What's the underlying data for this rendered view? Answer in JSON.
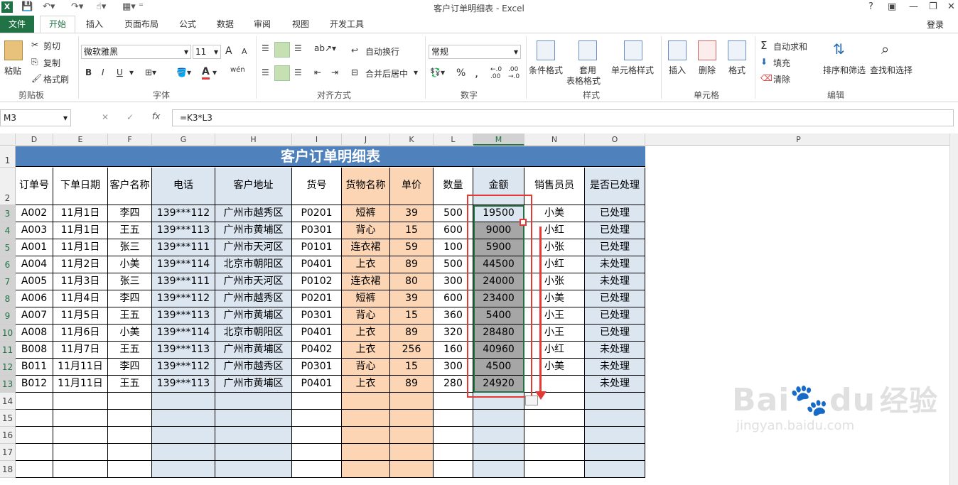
{
  "window": {
    "title": "客户订单明细表 - Excel",
    "help": "?",
    "app_icon": "X"
  },
  "tabs": [
    "文件",
    "开始",
    "插入",
    "页面布局",
    "公式",
    "数据",
    "审阅",
    "视图",
    "开发工具"
  ],
  "login": "登录",
  "ribbon": {
    "clipboard": {
      "paste": "粘贴",
      "cut": "剪切",
      "copy": "复制",
      "format_painter": "格式刷",
      "label": "剪贴板"
    },
    "font": {
      "name": "微软雅黑",
      "size": "11",
      "label": "字体",
      "bold": "B",
      "italic": "I",
      "underline": "U",
      "grow": "A",
      "shrink": "A",
      "color_a": "A",
      "phonetic": "wén"
    },
    "alignment": {
      "wrap": "自动换行",
      "merge": "合并后居中",
      "label": "对齐方式"
    },
    "number": {
      "format": "常规",
      "percent": "%",
      "comma": ",",
      "label": "数字",
      "inc_decimal": "←.0 .00",
      "dec_decimal": ".00 →.0"
    },
    "styles": {
      "conditional": "条件格式",
      "table": "套用",
      "table2": "表格格式",
      "cell": "单元格样式",
      "label": "样式"
    },
    "cells": {
      "insert": "插入",
      "delete": "删除",
      "format": "格式",
      "label": "单元格"
    },
    "editing": {
      "autosum": "自动求和",
      "fill": "填充",
      "clear": "清除",
      "sort": "排序和筛选",
      "find": "查找和选择",
      "label": "编辑"
    }
  },
  "formula_bar": {
    "name_box": "M3",
    "formula": "=K3*L3",
    "fx": "fx",
    "cancel": "✕",
    "enter": "✓"
  },
  "columns": [
    {
      "letter": "D"
    },
    {
      "letter": "E"
    },
    {
      "letter": "F"
    },
    {
      "letter": "G"
    },
    {
      "letter": "H"
    },
    {
      "letter": "I"
    },
    {
      "letter": "J"
    },
    {
      "letter": "K"
    },
    {
      "letter": "L"
    },
    {
      "letter": "M"
    },
    {
      "letter": "N"
    },
    {
      "letter": "O"
    },
    {
      "letter": "P"
    }
  ],
  "sheet_title": "客户订单明细表",
  "headers": [
    "订单号",
    "下单日期",
    "客户名称",
    "电话",
    "客户地址",
    "货号",
    "货物名称",
    "单价",
    "数量",
    "金额",
    "销售员员",
    "是否已处理"
  ],
  "rows": [
    [
      "A002",
      "11月1日",
      "李四",
      "139***112",
      "广州市越秀区",
      "P0201",
      "短裤",
      "39",
      "500",
      "19500",
      "小美",
      "已处理"
    ],
    [
      "A003",
      "11月1日",
      "王五",
      "139***113",
      "广州市黄埔区",
      "P0301",
      "背心",
      "15",
      "600",
      "9000",
      "小红",
      "已处理"
    ],
    [
      "A001",
      "11月1日",
      "张三",
      "139***111",
      "广州市天河区",
      "P0101",
      "连衣裙",
      "59",
      "100",
      "5900",
      "小张",
      "已处理"
    ],
    [
      "A004",
      "11月2日",
      "小美",
      "139***114",
      "北京市朝阳区",
      "P0401",
      "上衣",
      "89",
      "500",
      "44500",
      "小红",
      "未处理"
    ],
    [
      "A005",
      "11月3日",
      "张三",
      "139***111",
      "广州市天河区",
      "P0102",
      "连衣裙",
      "80",
      "300",
      "24000",
      "小张",
      "未处理"
    ],
    [
      "A006",
      "11月4日",
      "李四",
      "139***112",
      "广州市越秀区",
      "P0201",
      "短裤",
      "39",
      "600",
      "23400",
      "小美",
      "已处理"
    ],
    [
      "A007",
      "11月5日",
      "王五",
      "139***113",
      "广州市黄埔区",
      "P0301",
      "背心",
      "15",
      "360",
      "5400",
      "小王",
      "已处理"
    ],
    [
      "A008",
      "11月6日",
      "小美",
      "139***114",
      "北京市朝阳区",
      "P0401",
      "上衣",
      "89",
      "320",
      "28480",
      "小王",
      "已处理"
    ],
    [
      "B008",
      "11月7日",
      "王五",
      "139***113",
      "广州市黄埔区",
      "P0402",
      "上衣",
      "256",
      "160",
      "40960",
      "小红",
      "未处理"
    ],
    [
      "B011",
      "11月11日",
      "李四",
      "139***112",
      "广州市越秀区",
      "P0301",
      "背心",
      "15",
      "300",
      "4500",
      "小美",
      "未处理"
    ],
    [
      "B012",
      "11月11日",
      "王五",
      "139***113",
      "广州市黄埔区",
      "P0401",
      "上衣",
      "89",
      "280",
      "24920",
      "",
      "未处理"
    ]
  ],
  "row_numbers": [
    "1",
    "2",
    "3",
    "4",
    "5",
    "6",
    "7",
    "8",
    "9",
    "10",
    "11",
    "12",
    "13",
    "14",
    "15",
    "16",
    "17",
    "18"
  ],
  "watermark": {
    "brand": "Bai",
    "brand2": "du",
    "cn": "经验",
    "url": "jingyan.baidu.com"
  },
  "colors": {
    "accent": "#217346",
    "header_blue": "#4f81bd",
    "col_blue": "#dce6f1",
    "col_orange": "#fcd5b4",
    "selection_gray": "#a6a6a6",
    "annotation_red": "#e53935"
  }
}
